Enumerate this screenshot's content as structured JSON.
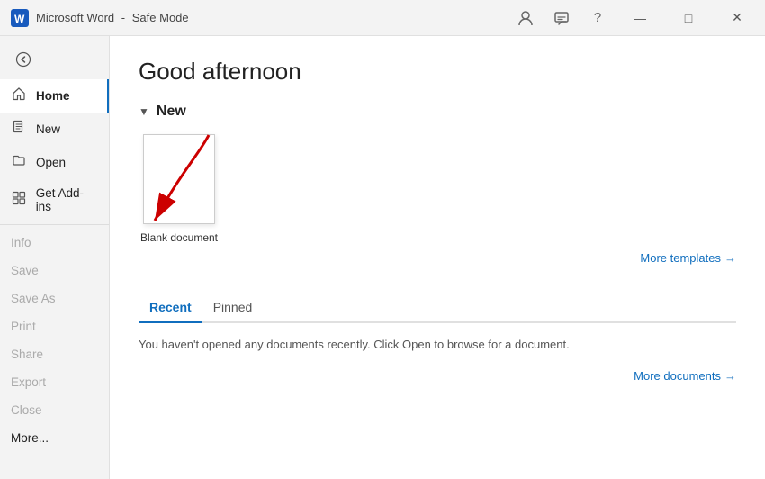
{
  "titleBar": {
    "appName": "Microsoft Word",
    "separator": "-",
    "mode": "Safe Mode",
    "icons": {
      "user": "👤",
      "feedback": "🚩",
      "help": "?"
    },
    "controls": {
      "minimize": "—",
      "maximize": "□",
      "close": "✕"
    }
  },
  "sidebar": {
    "backIcon": "←",
    "items": [
      {
        "id": "home",
        "label": "Home",
        "icon": "🏠",
        "active": true,
        "disabled": false
      },
      {
        "id": "new",
        "label": "New",
        "icon": "📄",
        "active": false,
        "disabled": false
      },
      {
        "id": "open",
        "label": "Open",
        "icon": "📂",
        "active": false,
        "disabled": false
      },
      {
        "id": "addins",
        "label": "Get Add-ins",
        "icon": "⊞",
        "active": false,
        "disabled": false
      },
      {
        "id": "info",
        "label": "Info",
        "icon": "",
        "active": false,
        "disabled": true
      },
      {
        "id": "save",
        "label": "Save",
        "icon": "",
        "active": false,
        "disabled": true
      },
      {
        "id": "saveas",
        "label": "Save As",
        "icon": "",
        "active": false,
        "disabled": true
      },
      {
        "id": "print",
        "label": "Print",
        "icon": "",
        "active": false,
        "disabled": true
      },
      {
        "id": "share",
        "label": "Share",
        "icon": "",
        "active": false,
        "disabled": true
      },
      {
        "id": "export",
        "label": "Export",
        "icon": "",
        "active": false,
        "disabled": true
      },
      {
        "id": "close",
        "label": "Close",
        "icon": "",
        "active": false,
        "disabled": true
      },
      {
        "id": "more",
        "label": "More...",
        "icon": "",
        "active": false,
        "disabled": false
      }
    ]
  },
  "main": {
    "greeting": "Good afternoon",
    "newSection": {
      "toggleIcon": "▼",
      "title": "New",
      "templates": [
        {
          "id": "blank",
          "label": "Blank document"
        }
      ],
      "moreTemplatesLabel": "More templates",
      "moreTemplatesArrow": "→"
    },
    "tabs": [
      {
        "id": "recent",
        "label": "Recent",
        "active": true
      },
      {
        "id": "pinned",
        "label": "Pinned",
        "active": false
      }
    ],
    "emptyState": "You haven't opened any documents recently. Click Open to browse for a document.",
    "moreDocumentsLabel": "More documents",
    "moreDocumentsArrow": "→"
  }
}
